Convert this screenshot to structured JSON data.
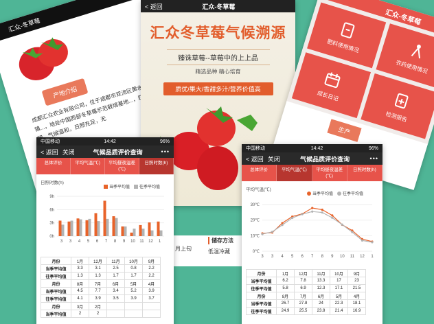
{
  "origin_card": {
    "header": "汇众-冬草莓",
    "tag": "产地介绍",
    "text": "成都汇众农业有限公司，位于成都市双流区黄水镇...，地处中国西部冬草莓示范栽培基地...，四季分明，气候温和，日照充足，无"
  },
  "poster": {
    "back": "返回",
    "title_bar": "汇众-冬草莓",
    "headline": "汇众冬草莓气候溯源",
    "sub": "臻诛草莓--草莓中的上上品",
    "sub2": "精选品种  精心培育",
    "bar": "质优/果大/香甜多汁/营养价值高",
    "storage_title": "储存方法",
    "storage_text": "低温冷藏",
    "harvest": "月上旬"
  },
  "menu_card": {
    "header": "汇众-冬草莓",
    "tiles": [
      "肥料使用情况",
      "农药使用情况",
      "成长日记",
      "检测报告"
    ],
    "more": "生产"
  },
  "phone_left": {
    "status": {
      "carrier": "中国移动",
      "time": "14:42",
      "battery": "96%"
    },
    "nav": {
      "back": "返回",
      "close": "关闭",
      "title": "气候品质评价查询",
      "more": "•••"
    },
    "tabs": [
      "总体评价",
      "平均气温(℃)",
      "平均昼夜温差(℃)",
      "日照时数(h)"
    ],
    "active_tab": 3,
    "chart_label": "日照时数(h)",
    "table": [
      [
        "月份",
        "1月",
        "12月",
        "11月",
        "10月",
        "9月"
      ],
      [
        "当季平均值",
        "3.3",
        "3.1",
        "2.5",
        "0.8",
        "2.2"
      ],
      [
        "往季平均值",
        "1.3",
        "1.3",
        "1.7",
        "1.7",
        "2.2"
      ],
      [
        "月份",
        "8月",
        "7月",
        "6月",
        "5月",
        "4月"
      ],
      [
        "当季平均值",
        "4.5",
        "7.7",
        "3.4",
        "5.2",
        "3.9"
      ],
      [
        "往季平均值",
        "4.1",
        "3.9",
        "3.5",
        "3.9",
        "3.7"
      ],
      [
        "月份",
        "3月",
        "2月",
        "",
        "",
        ""
      ],
      [
        "当季平均值",
        "2",
        "2",
        "",
        "",
        ""
      ]
    ]
  },
  "phone_right": {
    "status": {
      "carrier": "中国移动",
      "time": "14:42",
      "battery": "96%"
    },
    "nav": {
      "back": "返回",
      "close": "关闭",
      "title": "气候品质评价查询",
      "more": "•••"
    },
    "tabs": [
      "总体评价",
      "平均气温(℃)",
      "平均昼夜温差(℃)",
      "日照时数(h)"
    ],
    "active_tab": 1,
    "chart_label": "平均气温(℃)",
    "table": [
      [
        "月份",
        "1月",
        "12月",
        "11月",
        "10月",
        "9月"
      ],
      [
        "当季平均值",
        "6.2",
        "7.8",
        "13.3",
        "17",
        "23"
      ],
      [
        "往季平均值",
        "5.8",
        "6.9",
        "12.3",
        "17.1",
        "21.5"
      ],
      [
        "月份",
        "8月",
        "7月",
        "6月",
        "5月",
        "4月"
      ],
      [
        "当季平均值",
        "26.7",
        "27.8",
        "24",
        "22.3",
        "18.1"
      ],
      [
        "往季平均值",
        "24.9",
        "25.5",
        "23.8",
        "21.4",
        "16.9"
      ]
    ]
  },
  "chart_data": [
    {
      "type": "bar",
      "legend": [
        "当季平均值",
        "往季平均值"
      ],
      "categories": [
        "3",
        "3",
        "4",
        "5",
        "6",
        "7",
        "8",
        "9",
        "10",
        "11",
        "12",
        "1"
      ],
      "series": [
        {
          "name": "当季平均值",
          "values": [
            3.5,
            3.3,
            4.0,
            3.6,
            5.2,
            8.0,
            4.5,
            2.2,
            0.8,
            2.5,
            3.1,
            3.3
          ]
        },
        {
          "name": "往季平均值",
          "values": [
            2.6,
            3.5,
            3.8,
            3.9,
            3.4,
            3.9,
            4.1,
            2.2,
            1.7,
            1.7,
            1.3,
            1.3
          ]
        }
      ],
      "yticks": [
        "0h",
        "3h",
        "6h",
        "9h"
      ],
      "ylim": [
        0,
        9
      ],
      "colors": {
        "current": "#e8632a",
        "past": "#b3b3b3"
      }
    },
    {
      "type": "line",
      "legend": [
        "当季平均值",
        "往季平均值"
      ],
      "categories": [
        "3",
        "3",
        "4",
        "5",
        "6",
        "7",
        "8",
        "9",
        "10",
        "11",
        "12",
        "1"
      ],
      "series": [
        {
          "name": "当季平均值",
          "values": [
            11.5,
            12.0,
            18.1,
            22.3,
            24,
            27.8,
            26.7,
            23,
            17,
            13.3,
            7.8,
            6.2
          ]
        },
        {
          "name": "往季平均值",
          "values": [
            11,
            12.5,
            16.9,
            21.4,
            23.8,
            25.5,
            24.9,
            21.5,
            17.1,
            12.3,
            6.9,
            5.8
          ]
        }
      ],
      "yticks": [
        "0℃",
        "10℃",
        "20℃",
        "30℃"
      ],
      "ylim": [
        0,
        30
      ],
      "colors": {
        "current": "#e8632a",
        "past": "#b3b3b3"
      }
    }
  ]
}
